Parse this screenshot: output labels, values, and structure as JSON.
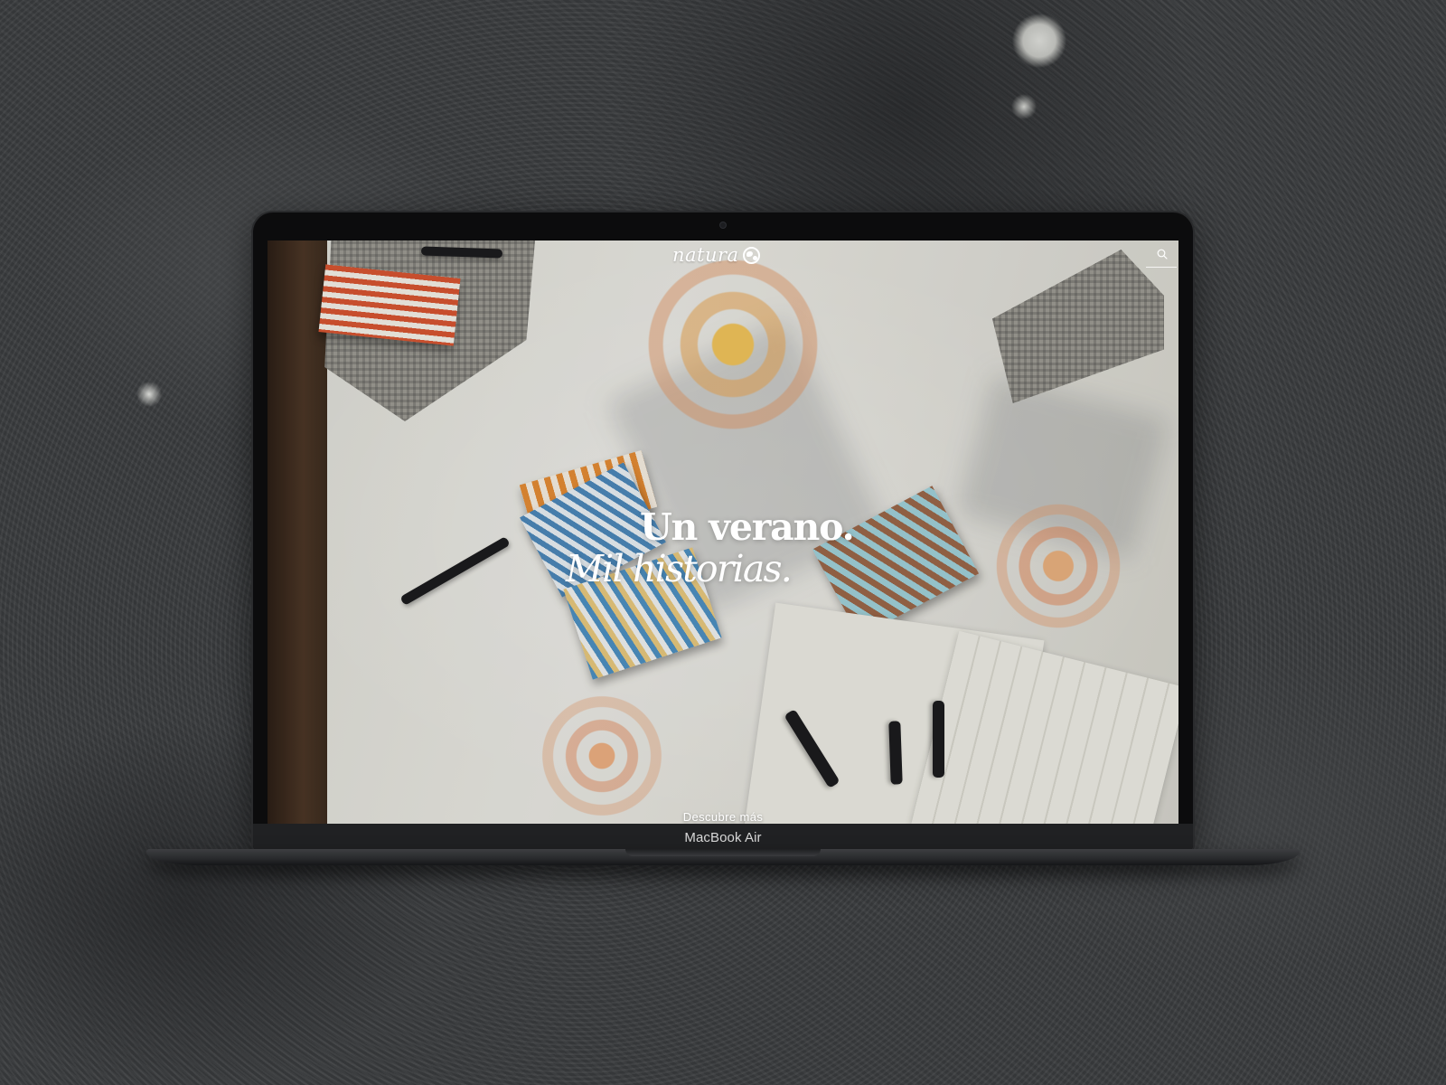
{
  "site": {
    "logo_text": "natura",
    "logo_icon": "globe-icon",
    "search_icon": "search-icon"
  },
  "hero": {
    "line1": "Un verano.",
    "line2": "Mil historias.",
    "cta": "Descubre más"
  },
  "device": {
    "model_label": "MacBook Air"
  },
  "colors": {
    "text": "#ffffff",
    "laptop_body": "#0c0c0d",
    "background": "#3a3c3e"
  }
}
